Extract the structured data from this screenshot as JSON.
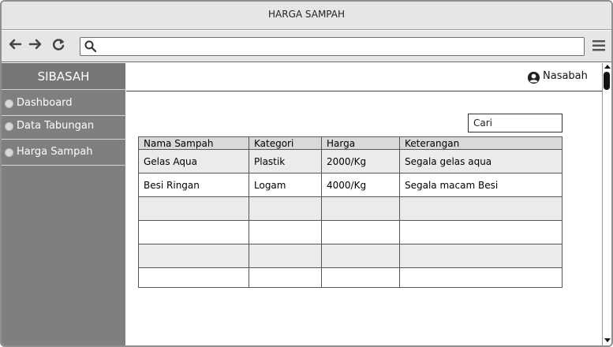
{
  "window": {
    "title": "HARGA SAMPAH"
  },
  "browser": {
    "back_icon": "arrow-left-icon",
    "forward_icon": "arrow-right-icon",
    "reload_icon": "reload-icon",
    "search_icon": "search-icon",
    "menu_icon": "hamburger-menu-icon",
    "url_value": ""
  },
  "sidebar": {
    "brand": "SIBASAH",
    "items": [
      {
        "label": "Dashboard"
      },
      {
        "label": "Data Tabungan"
      },
      {
        "label": "Harga Sampah"
      }
    ]
  },
  "header": {
    "user_label": "Nasabah",
    "user_icon": "user-circle-icon"
  },
  "search": {
    "value": "Cari"
  },
  "table": {
    "columns": [
      "Nama Sampah",
      "Kategori",
      "Harga",
      "Keterangan"
    ],
    "rows": [
      [
        "Gelas Aqua",
        "Plastik",
        "2000/Kg",
        "Segala gelas aqua"
      ],
      [
        "Besi Ringan",
        "Logam",
        "4000/Kg",
        "Segala macam Besi"
      ],
      [
        "",
        "",
        "",
        ""
      ],
      [
        "",
        "",
        "",
        ""
      ],
      [
        "",
        "",
        "",
        ""
      ],
      [
        "",
        "",
        "",
        ""
      ]
    ]
  },
  "colors": {
    "sidebar_bg": "#7f7f7f",
    "chrome_bg": "#e6e6e6",
    "table_header_bg": "#d9d9d9",
    "row_shade_bg": "#ebebeb"
  }
}
